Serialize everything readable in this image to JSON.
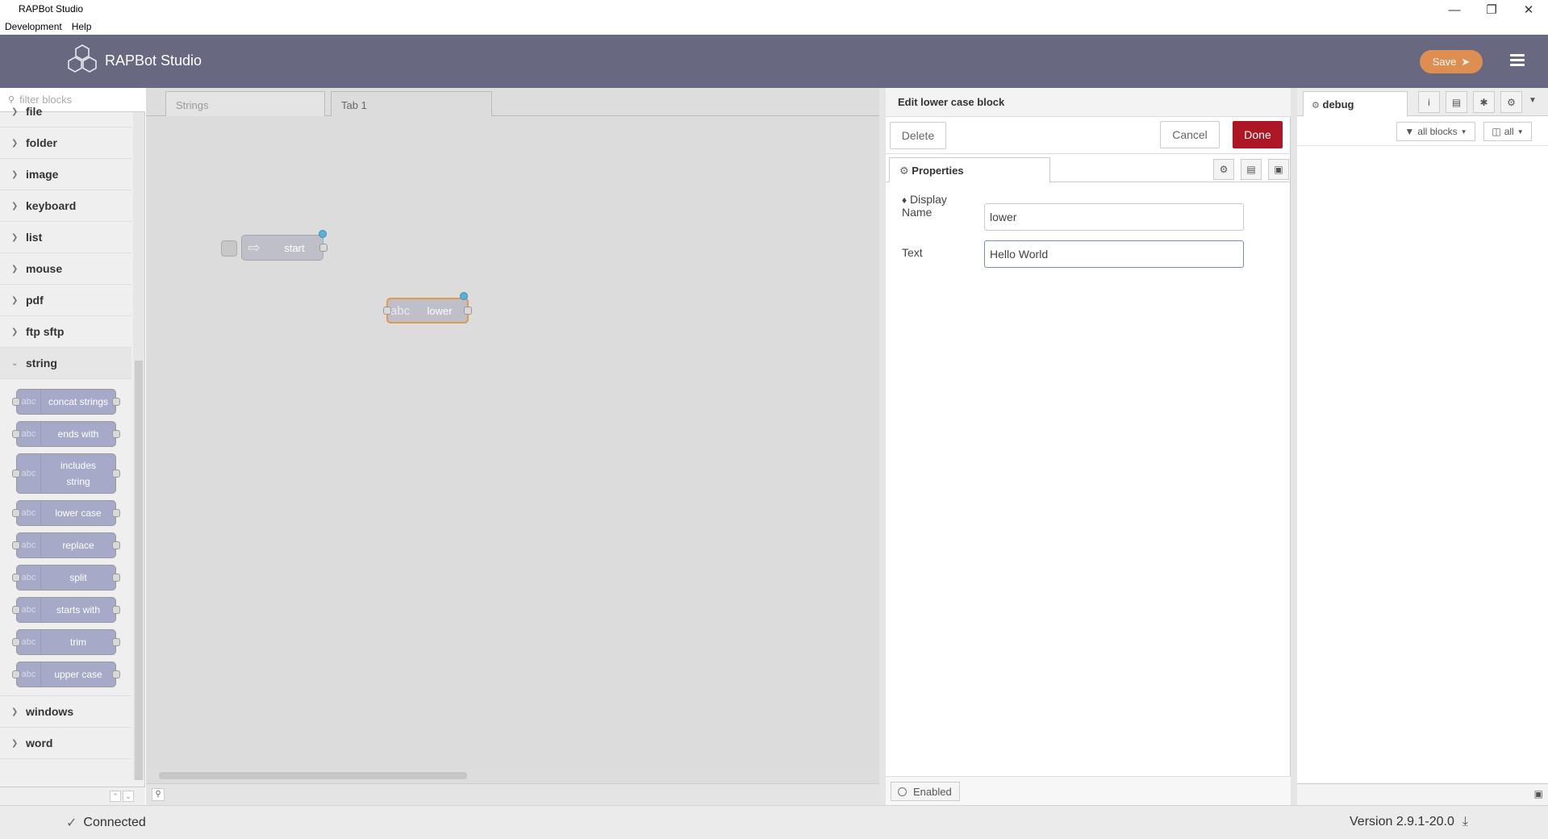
{
  "window": {
    "title": "RAPBot Studio",
    "menu": [
      "Development",
      "Help"
    ]
  },
  "header": {
    "app_name": "RAPBot Studio",
    "save_label": "Save",
    "brand_color": "#686880",
    "save_color": "#e6914f"
  },
  "palette": {
    "filter_placeholder": "filter blocks",
    "categories_top": [
      "file",
      "folder",
      "image",
      "keyboard",
      "list",
      "mouse",
      "pdf",
      "ftp sftp"
    ],
    "open_category": "string",
    "blocks": [
      {
        "icon": "abc",
        "label": "concat strings"
      },
      {
        "icon": "abc",
        "label": "ends with"
      },
      {
        "icon": "abc",
        "label": "includes string"
      },
      {
        "icon": "abc",
        "label": "lower case"
      },
      {
        "icon": "abc",
        "label": "replace"
      },
      {
        "icon": "abc",
        "label": "split"
      },
      {
        "icon": "abc",
        "label": "starts with"
      },
      {
        "icon": "abc",
        "label": "trim"
      },
      {
        "icon": "abc",
        "label": "upper case"
      }
    ],
    "categories_bottom": [
      "windows",
      "word"
    ]
  },
  "workspace": {
    "tabs": [
      {
        "label": "Strings"
      },
      {
        "label": "Tab 1"
      }
    ],
    "nodes": {
      "start": {
        "label": "start"
      },
      "lower": {
        "icon": "abc",
        "label": "lower"
      }
    }
  },
  "tray": {
    "title": "Edit lower case block",
    "delete_label": "Delete",
    "cancel_label": "Cancel",
    "done_label": "Done",
    "done_color": "#ad1625",
    "properties_tab": "Properties",
    "display_name_label_1": "Display",
    "display_name_label_2": "Name",
    "display_name_value": "lower",
    "text_label": "Text",
    "text_value": "Hello World",
    "enabled_label": "Enabled"
  },
  "sidebar": {
    "tab_label": "debug",
    "filter_label": "all blocks",
    "clear_label": "all"
  },
  "status": {
    "connection": "Connected",
    "version": "Version 2.9.1-20.0"
  }
}
